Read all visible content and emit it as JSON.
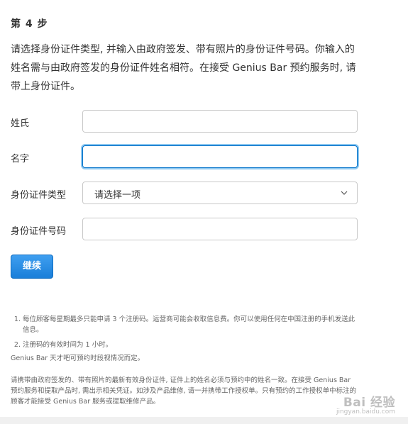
{
  "step": {
    "title": "第 4 步",
    "instructions": "请选择身份证件类型, 并输入由政府签发、带有照片的身份证件号码。你输入的姓名需与由政府签发的身份证件姓名相符。在接受 Genius Bar 预约服务时, 请带上身份证件。"
  },
  "form": {
    "surname_label": "姓氏",
    "surname_value": "",
    "given_name_label": "名字",
    "given_name_value": "",
    "id_type_label": "身份证件类型",
    "id_type_selected": "请选择一项",
    "id_number_label": "身份证件号码",
    "id_number_value": ""
  },
  "continue_label": "继续",
  "notes": {
    "items": [
      "每位顾客每星期最多只能申请 3 个注册码。运营商可能会收取信息费。你可以使用任何在中国注册的手机发送此信息。",
      "注册码的有效时间为 1 小时。"
    ],
    "plain": "Genius Bar 天才吧可预约时段视情况而定。",
    "footer": "请携带由政府签发的、带有照片的最新有效身份证件, 证件上的姓名必须与预约中的姓名一致。在接受 Genius Bar 预约服务和提取产品时, 需出示相关凭证。如涉及产品维修, 请一并携带工作授权单。只有预约的工作授权单中标注的顾客才能接受 Genius Bar 服务或提取维修产品。"
  },
  "watermark": {
    "main": "Bai 经验",
    "sub": "jingyan.baidu.com"
  },
  "colors": {
    "focus_border": "#0070c9",
    "button": "#1a7fd9"
  }
}
